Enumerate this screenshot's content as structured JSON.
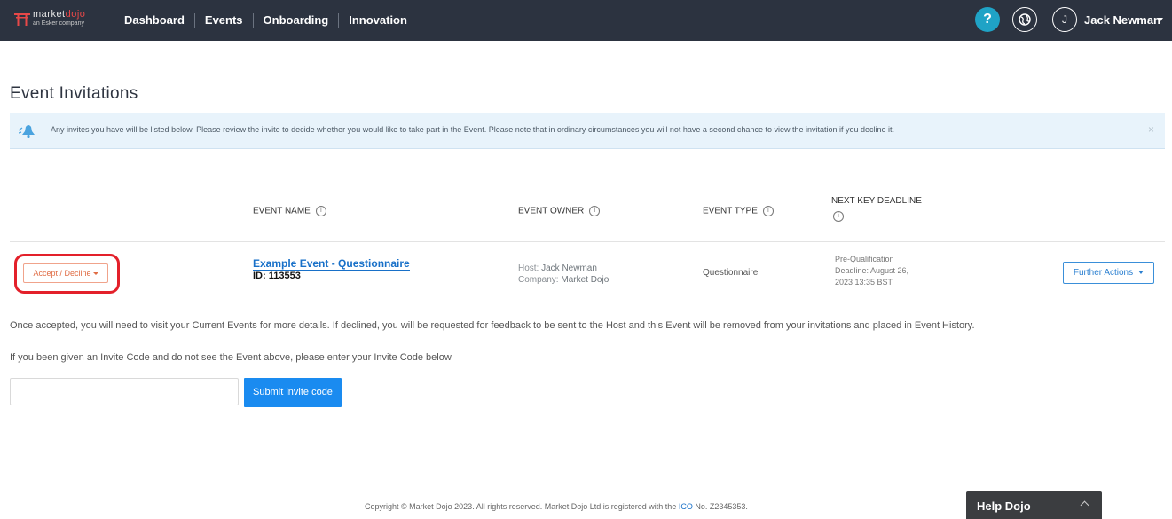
{
  "nav": {
    "logo": {
      "brand_part1": "market",
      "brand_part2": "dojo",
      "sub": "an Esker company"
    },
    "links": [
      "Dashboard",
      "Events",
      "Onboarding",
      "Innovation"
    ],
    "help_symbol": "?",
    "user_initial": "J",
    "user_name": "Jack Newman"
  },
  "page": {
    "title": "Event Invitations",
    "alert": "Any invites you have will be listed below. Please review the invite to decide whether you would like to take part in the Event. Please note that in ordinary circumstances you will not have a second chance to view the invitation if you decline it.",
    "alert_close": "×"
  },
  "table": {
    "headers": {
      "event_name": "EVENT NAME",
      "event_owner": "EVENT OWNER",
      "event_type": "EVENT TYPE",
      "next_deadline": "NEXT KEY DEADLINE"
    },
    "info_symbol": "i",
    "row": {
      "accept_label": "Accept / Decline",
      "event_name": "Example Event - Questionnaire",
      "event_id": "ID: 113553",
      "host_label": "Host:",
      "host_value": "Jack Newman",
      "company_label": "Company:",
      "company_value": "Market Dojo",
      "event_type": "Questionnaire",
      "deadline_line1": "Pre-Qualification",
      "deadline_line2": "Deadline: August 26,",
      "deadline_line3": "2023 13:35 BST",
      "further_actions": "Further Actions"
    }
  },
  "info_text": {
    "accepted_note": "Once accepted, you will need to visit your Current Events for more details. If declined, you will be requested for feedback to be sent to the Host and this Event will be removed from your invitations and placed in Event History.",
    "invite_code_note": "If you been given an Invite Code and do not see the Event above, please enter your Invite Code below"
  },
  "invite": {
    "input_value": "",
    "submit_label": "Submit invite code"
  },
  "footer": {
    "text_before": "Copyright © Market Dojo 2023. All rights reserved. Market Dojo Ltd is registered with the",
    "ico_link": "ICO",
    "text_after": "No. Z2345353."
  },
  "help_widget": {
    "label": "Help Dojo"
  },
  "colors": {
    "nav_bg": "#2c3340",
    "accent_blue": "#1a8bf0",
    "accept_orange": "#e06d45",
    "highlight_red": "#e3202a",
    "alert_bg": "#e8f3fb"
  }
}
